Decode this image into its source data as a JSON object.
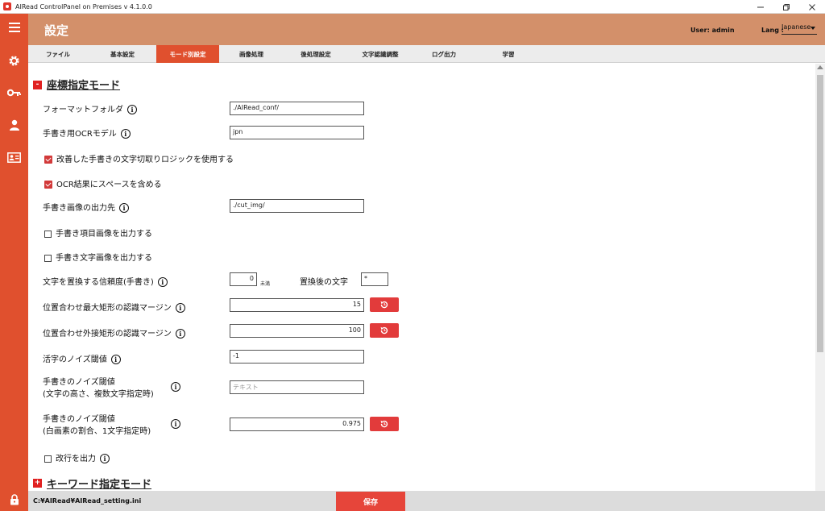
{
  "window": {
    "title": "AIRead ControlPanel on Premises v 4.1.0.0"
  },
  "header": {
    "title": "設定",
    "user": "User: admin",
    "lang_label": "Lang :",
    "lang_value": "Japanese"
  },
  "tabs": [
    {
      "label": "ファイル"
    },
    {
      "label": "基本設定"
    },
    {
      "label": "モード別設定"
    },
    {
      "label": "画像処理"
    },
    {
      "label": "後処理設定"
    },
    {
      "label": "文字認識調整"
    },
    {
      "label": "ログ出力"
    },
    {
      "label": "学習"
    }
  ],
  "active_tab": "モード別設定",
  "sections": {
    "coord": {
      "title": "座標指定モード",
      "toggle": "-"
    },
    "keyword": {
      "title": "キーワード指定モード",
      "toggle": "+"
    }
  },
  "fields": {
    "format_folder": {
      "label": "フォーマットフォルダ",
      "value": "./AIRead_conf/"
    },
    "hand_ocr_model": {
      "label": "手書き用OCRモデル",
      "value": "jpn"
    },
    "improved_logic": {
      "label": "改善した手書きの文字切取りロジックを使用する",
      "checked": true
    },
    "include_space": {
      "label": "OCR結果にスペースを含める",
      "checked": true
    },
    "hand_img_dest": {
      "label": "手書き画像の出力先",
      "value": "./cut_img/"
    },
    "out_item_img": {
      "label": "手書き項目画像を出力する",
      "checked": false
    },
    "out_char_img": {
      "label": "手書き文字画像を出力する",
      "checked": false
    },
    "replace_conf": {
      "label": "文字を置換する信頼度(手書き)",
      "value": "0",
      "unit": "未満"
    },
    "replace_char": {
      "label": "置換後の文字",
      "value": "*"
    },
    "max_rect_margin": {
      "label": "位置合わせ最大矩形の認識マージン",
      "value": "15"
    },
    "outer_rect_margin": {
      "label": "位置合わせ外接矩形の認識マージン",
      "value": "100"
    },
    "print_noise": {
      "label": "活字のノイズ閾値",
      "value": "-1"
    },
    "hand_noise_height": {
      "label_line1": "手書きのノイズ閾値",
      "label_line2": "(文字の高さ、複数文字指定時)",
      "placeholder": "テキスト"
    },
    "hand_noise_white": {
      "label_line1": "手書きのノイズ閾値",
      "label_line2": "(白画素の割合、1文字指定時)",
      "value": "0.975"
    },
    "newline_out": {
      "label": "改行を出力",
      "checked": false
    }
  },
  "footer": {
    "path": "C:¥AIRead¥AIRead_setting.ini",
    "save_label": "保存"
  },
  "colors": {
    "sidebar": "#e0502e",
    "header": "#d3906a",
    "accent": "#e23b3b"
  }
}
